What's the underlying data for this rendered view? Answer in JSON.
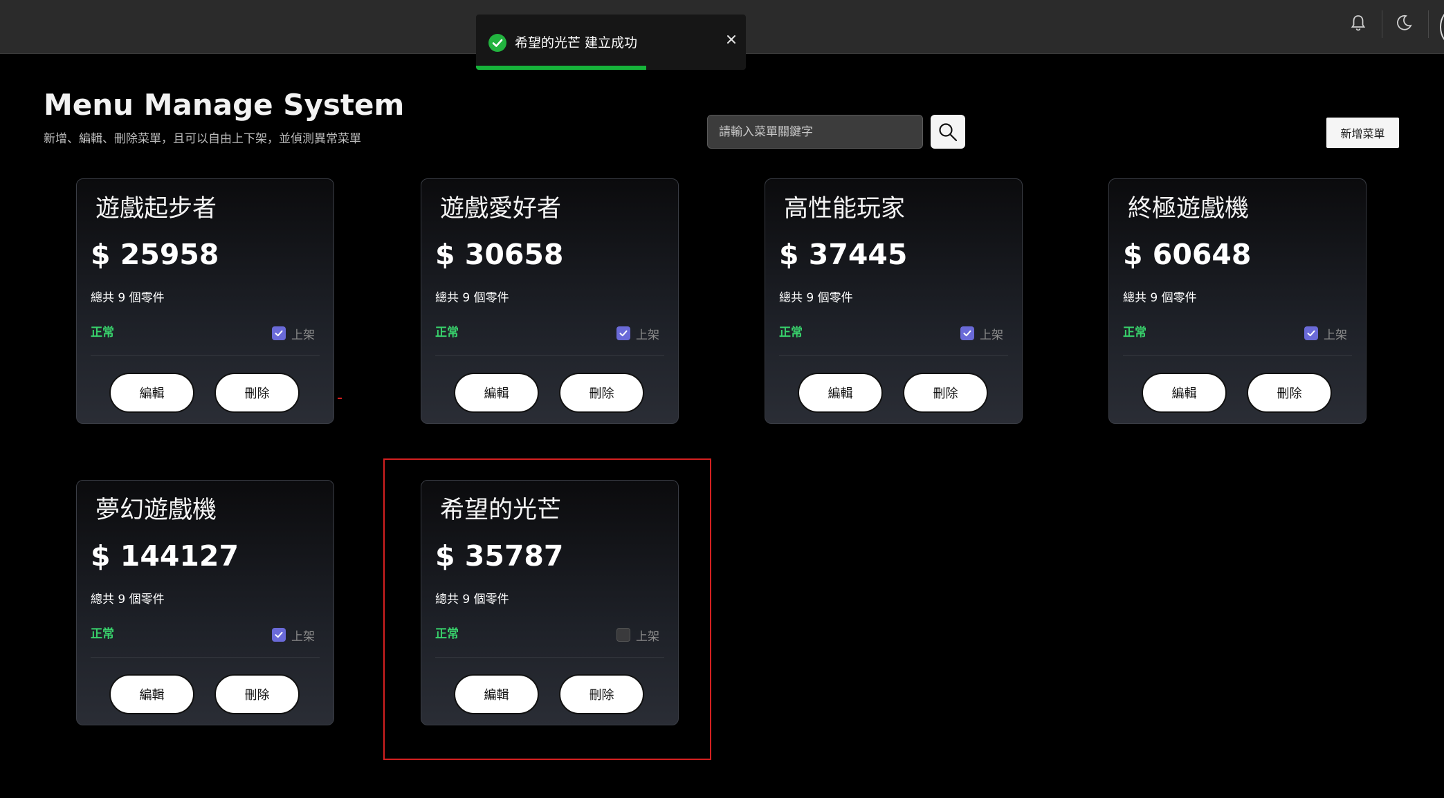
{
  "toast": {
    "message": "希望的光芒 建立成功",
    "progress": 0.63,
    "color": "#16b33a"
  },
  "header": {
    "title": "Menu Manage System",
    "subtitle": "新增、編輯、刪除菜單，且可以自由上下架，並偵測異常菜單"
  },
  "search": {
    "placeholder": "請輸入菜單關鍵字",
    "value": ""
  },
  "add_button": "新增菜單",
  "icons": {
    "notification": "bell-icon",
    "theme": "moon-icon",
    "search": "search-icon",
    "toast_status": "check-circle-icon",
    "toast_close": "close-icon"
  },
  "colors": {
    "status_normal": "#38d16b",
    "checkbox_on": "#6a6ad8",
    "highlight": "#d42020"
  },
  "menus": [
    {
      "name": "遊戲起步者",
      "price": "$ 25958",
      "parts": "總共 9 個零件",
      "status": "正常",
      "listed_label": "上架",
      "listed": true,
      "edit": "編輯",
      "delete": "刪除"
    },
    {
      "name": "遊戲愛好者",
      "price": "$ 30658",
      "parts": "總共 9 個零件",
      "status": "正常",
      "listed_label": "上架",
      "listed": true,
      "edit": "編輯",
      "delete": "刪除"
    },
    {
      "name": "高性能玩家",
      "price": "$ 37445",
      "parts": "總共 9 個零件",
      "status": "正常",
      "listed_label": "上架",
      "listed": true,
      "edit": "編輯",
      "delete": "刪除"
    },
    {
      "name": "終極遊戲機",
      "price": "$ 60648",
      "parts": "總共 9 個零件",
      "status": "正常",
      "listed_label": "上架",
      "listed": true,
      "edit": "編輯",
      "delete": "刪除"
    },
    {
      "name": "夢幻遊戲機",
      "price": "$ 144127",
      "parts": "總共 9 個零件",
      "status": "正常",
      "listed_label": "上架",
      "listed": true,
      "edit": "編輯",
      "delete": "刪除"
    },
    {
      "name": "希望的光芒",
      "price": "$ 35787",
      "parts": "總共 9 個零件",
      "status": "正常",
      "listed_label": "上架",
      "listed": false,
      "edit": "編輯",
      "delete": "刪除"
    }
  ]
}
